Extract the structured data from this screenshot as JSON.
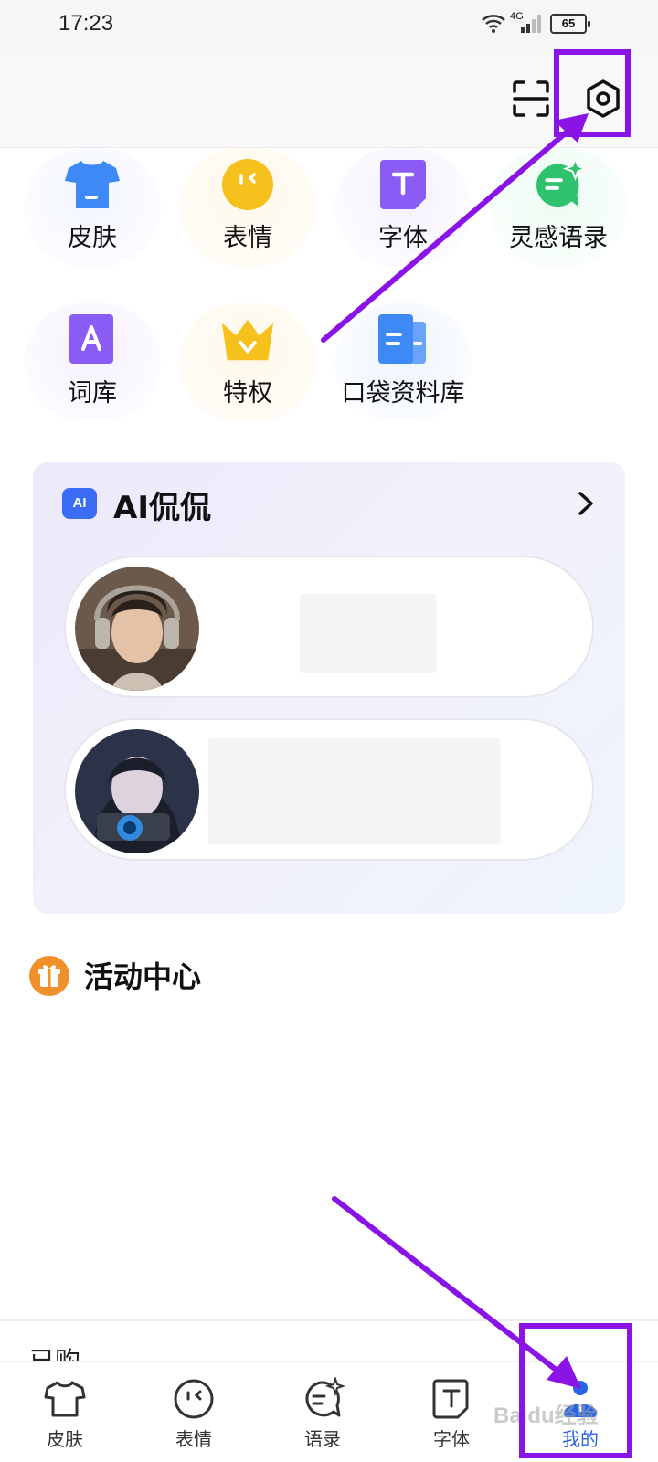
{
  "status_bar": {
    "time": "17:23",
    "network": "4G",
    "battery": "65"
  },
  "header": {
    "scan_icon": "scan-icon",
    "settings_icon": "settings-gear-icon"
  },
  "features": [
    {
      "label": "皮肤",
      "icon": "tshirt-icon",
      "color": "#3d8af7"
    },
    {
      "label": "表情",
      "icon": "emoji-face-icon",
      "color": "#f7c11d"
    },
    {
      "label": "字体",
      "icon": "font-t-icon",
      "color": "#8a5cf5"
    },
    {
      "label": "灵感语录",
      "icon": "sparkle-chat-icon",
      "color": "#2dc26b"
    },
    {
      "label": "词库",
      "icon": "lexicon-a-icon",
      "color": "#8a5cf5"
    },
    {
      "label": "特权",
      "icon": "crown-icon",
      "color": "#f7c11d"
    },
    {
      "label": "口袋资料库",
      "icon": "docs-icon",
      "color": "#3d8af7"
    }
  ],
  "ai_card": {
    "badge": "AI",
    "title": "AI侃侃",
    "arrow_icon": "chevron-right-icon"
  },
  "activity": {
    "title": "活动中心",
    "icon": "gift-icon",
    "color": "#f0902b"
  },
  "purchased": {
    "label": "已购"
  },
  "bottom_nav": [
    {
      "label": "皮肤",
      "icon": "tshirt-outline-icon"
    },
    {
      "label": "表情",
      "icon": "emoji-outline-icon"
    },
    {
      "label": "语录",
      "icon": "quote-outline-icon"
    },
    {
      "label": "字体",
      "icon": "font-outline-icon"
    },
    {
      "label": "我的",
      "icon": "person-filled-icon",
      "active": true
    }
  ],
  "watermark": "Baidu经验"
}
